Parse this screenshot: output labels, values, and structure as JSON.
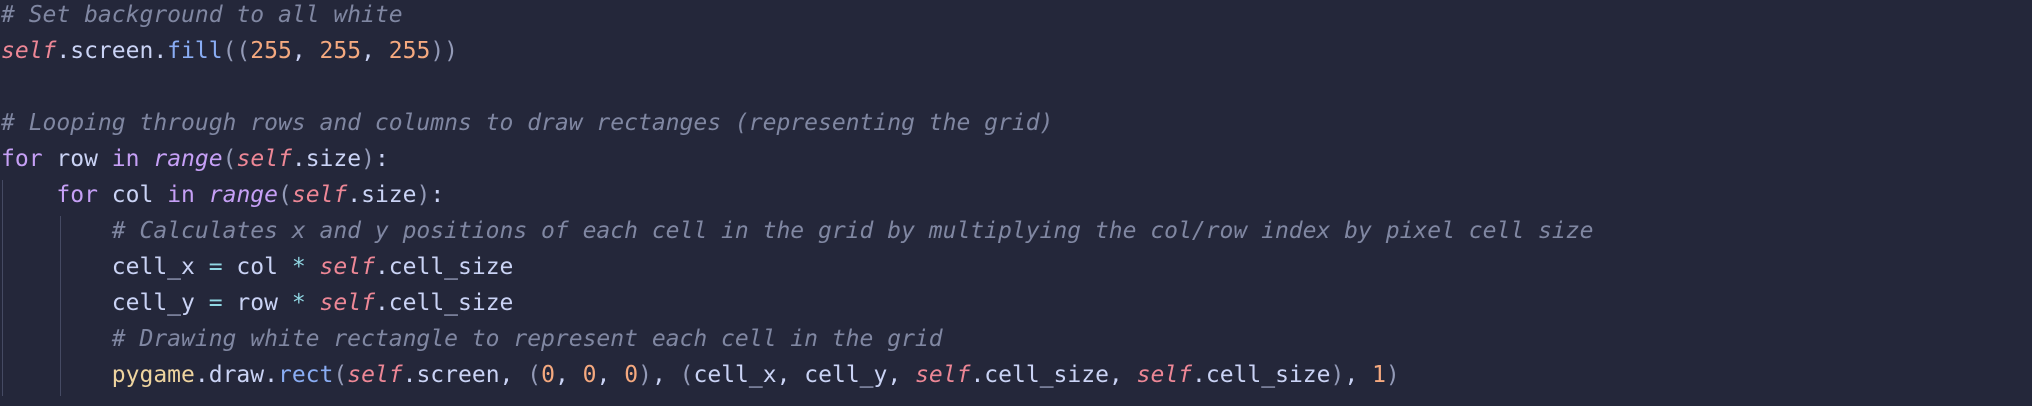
{
  "editor": {
    "colors": {
      "background": "#24273a",
      "comment": "#8087a2",
      "self": "#ed8796",
      "keyword": "#c6a0f6",
      "function": "#8aadf4",
      "number": "#f5a97f",
      "operator": "#91d7e3",
      "module": "#eed49f",
      "text": "#cad3f5"
    },
    "lines": [
      {
        "tokens": [
          {
            "type": "comment",
            "text": "# Set background to all white"
          }
        ]
      },
      {
        "tokens": [
          {
            "type": "self",
            "text": "self"
          },
          {
            "type": "plain",
            "text": ".screen."
          },
          {
            "type": "func",
            "text": "fill"
          },
          {
            "type": "paren",
            "text": "(("
          },
          {
            "type": "number",
            "text": "255"
          },
          {
            "type": "plain",
            "text": ", "
          },
          {
            "type": "number",
            "text": "255"
          },
          {
            "type": "plain",
            "text": ", "
          },
          {
            "type": "number",
            "text": "255"
          },
          {
            "type": "paren",
            "text": "))"
          }
        ]
      },
      {
        "tokens": []
      },
      {
        "tokens": [
          {
            "type": "comment",
            "text": "# Looping through rows and columns to draw rectanges (representing the grid)"
          }
        ]
      },
      {
        "tokens": [
          {
            "type": "keyword",
            "text": "for"
          },
          {
            "type": "plain",
            "text": " row "
          },
          {
            "type": "keyword",
            "text": "in"
          },
          {
            "type": "plain",
            "text": " "
          },
          {
            "type": "builtin",
            "text": "range"
          },
          {
            "type": "paren",
            "text": "("
          },
          {
            "type": "self",
            "text": "self"
          },
          {
            "type": "plain",
            "text": ".size"
          },
          {
            "type": "paren",
            "text": ")"
          },
          {
            "type": "plain",
            "text": ":"
          }
        ]
      },
      {
        "tokens": [
          {
            "type": "plain",
            "text": "    "
          },
          {
            "type": "keyword",
            "text": "for"
          },
          {
            "type": "plain",
            "text": " col "
          },
          {
            "type": "keyword",
            "text": "in"
          },
          {
            "type": "plain",
            "text": " "
          },
          {
            "type": "builtin",
            "text": "range"
          },
          {
            "type": "paren",
            "text": "("
          },
          {
            "type": "self",
            "text": "self"
          },
          {
            "type": "plain",
            "text": ".size"
          },
          {
            "type": "paren",
            "text": ")"
          },
          {
            "type": "plain",
            "text": ":"
          }
        ]
      },
      {
        "tokens": [
          {
            "type": "plain",
            "text": "        "
          },
          {
            "type": "comment",
            "text": "# Calculates x and y positions of each cell in the grid by multiplying the col/row index by pixel cell size"
          }
        ]
      },
      {
        "tokens": [
          {
            "type": "plain",
            "text": "        cell_x "
          },
          {
            "type": "operator",
            "text": "="
          },
          {
            "type": "plain",
            "text": " col "
          },
          {
            "type": "operator",
            "text": "*"
          },
          {
            "type": "plain",
            "text": " "
          },
          {
            "type": "self",
            "text": "self"
          },
          {
            "type": "plain",
            "text": ".cell_size"
          }
        ]
      },
      {
        "tokens": [
          {
            "type": "plain",
            "text": "        cell_y "
          },
          {
            "type": "operator",
            "text": "="
          },
          {
            "type": "plain",
            "text": " row "
          },
          {
            "type": "operator",
            "text": "*"
          },
          {
            "type": "plain",
            "text": " "
          },
          {
            "type": "self",
            "text": "self"
          },
          {
            "type": "plain",
            "text": ".cell_size"
          }
        ]
      },
      {
        "tokens": [
          {
            "type": "plain",
            "text": "        "
          },
          {
            "type": "comment",
            "text": "# Drawing white rectangle to represent each cell in the grid"
          }
        ]
      },
      {
        "tokens": [
          {
            "type": "plain",
            "text": "        "
          },
          {
            "type": "module",
            "text": "pygame"
          },
          {
            "type": "plain",
            "text": ".draw."
          },
          {
            "type": "func",
            "text": "rect"
          },
          {
            "type": "paren",
            "text": "("
          },
          {
            "type": "self",
            "text": "self"
          },
          {
            "type": "plain",
            "text": ".screen, "
          },
          {
            "type": "paren",
            "text": "("
          },
          {
            "type": "number",
            "text": "0"
          },
          {
            "type": "plain",
            "text": ", "
          },
          {
            "type": "number",
            "text": "0"
          },
          {
            "type": "plain",
            "text": ", "
          },
          {
            "type": "number",
            "text": "0"
          },
          {
            "type": "paren",
            "text": ")"
          },
          {
            "type": "plain",
            "text": ", "
          },
          {
            "type": "paren",
            "text": "("
          },
          {
            "type": "plain",
            "text": "cell_x, cell_y, "
          },
          {
            "type": "self",
            "text": "self"
          },
          {
            "type": "plain",
            "text": ".cell_size, "
          },
          {
            "type": "self",
            "text": "self"
          },
          {
            "type": "plain",
            "text": ".cell_size"
          },
          {
            "type": "paren",
            "text": ")"
          },
          {
            "type": "plain",
            "text": ", "
          },
          {
            "type": "number",
            "text": "1"
          },
          {
            "type": "paren",
            "text": ")"
          }
        ]
      }
    ]
  }
}
